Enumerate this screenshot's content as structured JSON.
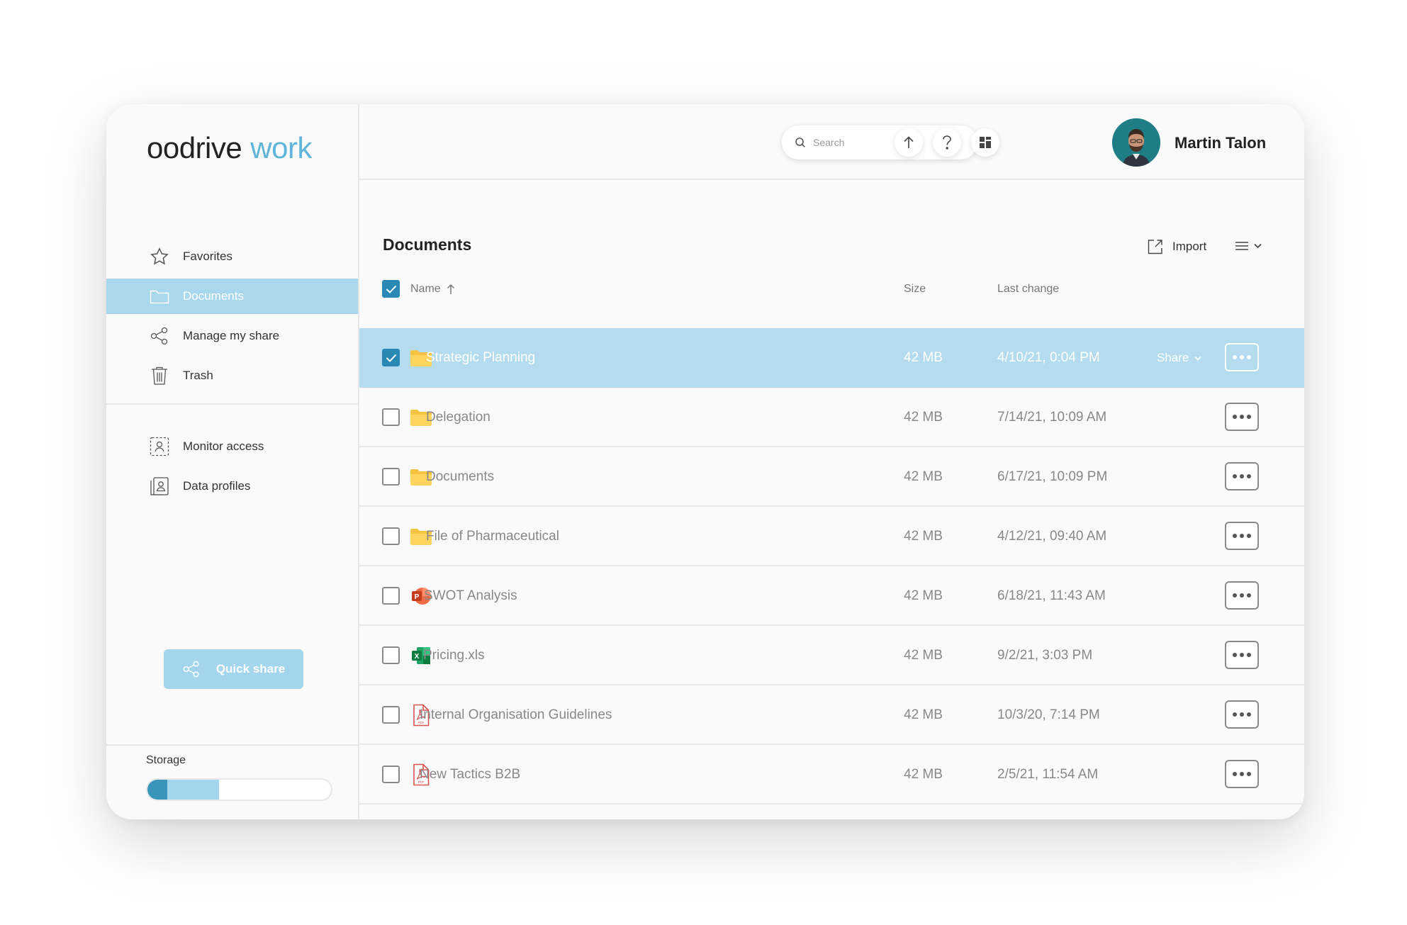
{
  "logo": {
    "brand": "oodrive",
    "product": "work"
  },
  "sidebar": {
    "nav": [
      {
        "label": "Favorites",
        "icon": "star-icon",
        "active": false
      },
      {
        "label": "Documents",
        "icon": "folder-icon",
        "active": true
      },
      {
        "label": "Manage my share",
        "icon": "share-icon",
        "active": false
      },
      {
        "label": "Trash",
        "icon": "trash-icon",
        "active": false
      }
    ],
    "nav2": [
      {
        "label": "Monitor access",
        "icon": "monitor-access-icon"
      },
      {
        "label": "Data profiles",
        "icon": "data-profiles-icon"
      }
    ],
    "quick_share_label": "Quick share",
    "storage_label": "Storage",
    "storage_used_fraction": 0.11,
    "storage_allocated_fraction": 0.39
  },
  "header": {
    "search_placeholder": "Search",
    "user_name": "Martin Talon"
  },
  "main": {
    "title": "Documents",
    "import_label": "Import",
    "columns": {
      "name": "Name",
      "size": "Size",
      "last_change": "Last change"
    },
    "share_label": "Share",
    "files": [
      {
        "name": "Strategic Planning",
        "type": "folder",
        "size": "42 MB",
        "date": "4/10/21, 0:04 PM",
        "selected": true
      },
      {
        "name": "Delegation",
        "type": "folder",
        "size": "42 MB",
        "date": "7/14/21, 10:09 AM",
        "selected": false
      },
      {
        "name": "Documents",
        "type": "folder",
        "size": "42 MB",
        "date": "6/17/21, 10:09 PM",
        "selected": false
      },
      {
        "name": "File of Pharmaceutical",
        "type": "folder",
        "size": "42 MB",
        "date": "4/12/21, 09:40 AM",
        "selected": false
      },
      {
        "name": "SWOT Analysis",
        "type": "powerpoint",
        "size": "42 MB",
        "date": "6/18/21, 11:43 AM",
        "selected": false
      },
      {
        "name": "Pricing.xls",
        "type": "excel",
        "size": "42 MB",
        "date": "9/2/21, 3:03 PM",
        "selected": false
      },
      {
        "name": "Internal Organisation Guidelines",
        "type": "pdf",
        "size": "42 MB",
        "date": "10/3/20, 7:14 PM",
        "selected": false
      },
      {
        "name": "New Tactics B2B",
        "type": "pdf",
        "size": "42 MB",
        "date": "2/5/21, 11:54 AM",
        "selected": false
      }
    ]
  },
  "colors": {
    "accent": "#5fb4d9",
    "selected_row": "#b5dcee",
    "checkbox": "#2a89b4"
  }
}
